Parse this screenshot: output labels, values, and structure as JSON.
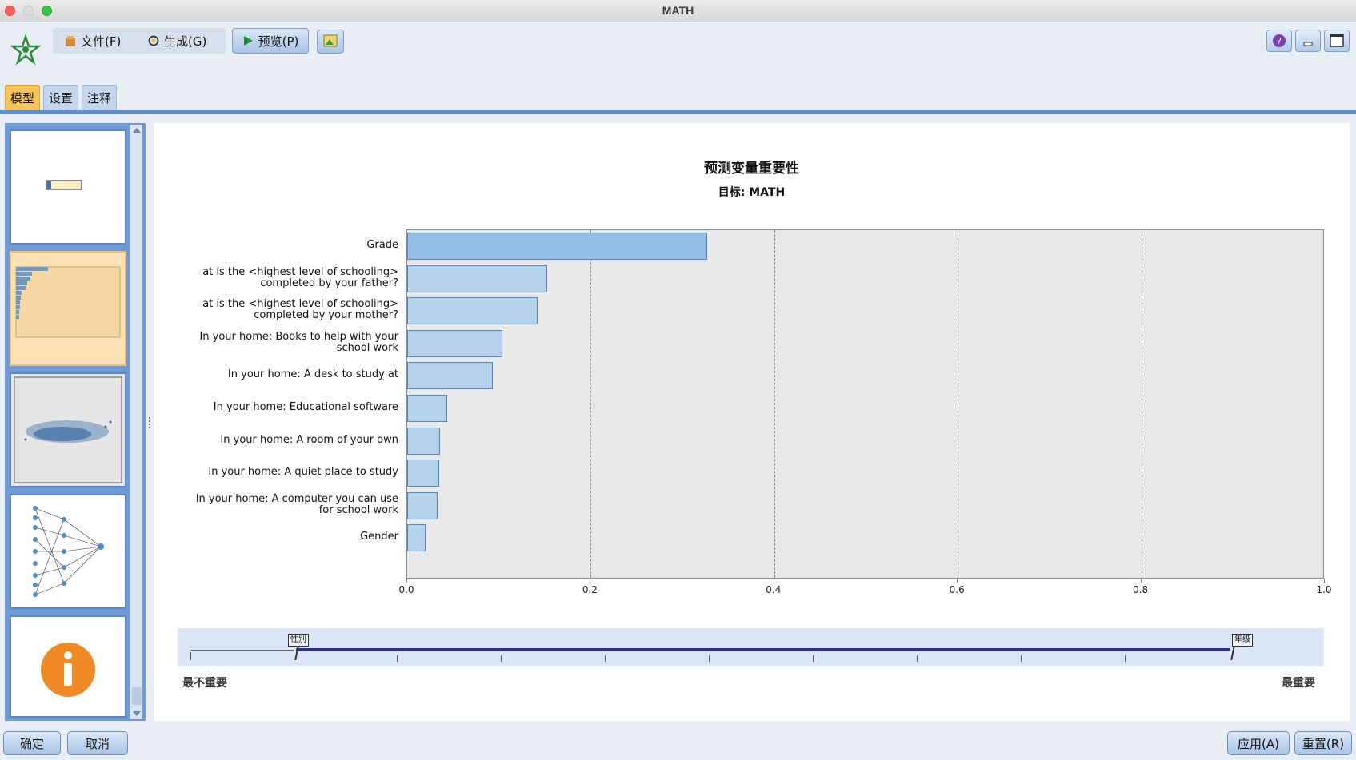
{
  "window": {
    "title": "MATH"
  },
  "toolbar": {
    "file_label": "文件(F)",
    "generate_label": "生成(G)",
    "preview_label": "预览(P)"
  },
  "tabs": [
    {
      "label": "模型",
      "active": true
    },
    {
      "label": "设置",
      "active": false
    },
    {
      "label": "注释",
      "active": false
    }
  ],
  "colors": {
    "accent": "#5b8fd2",
    "bar_fill": "#b6d1ea",
    "bar_border": "#4f88c3",
    "tab_active": "#f6c55a",
    "info_icon": "#f08a24"
  },
  "chart_data": {
    "type": "bar",
    "orientation": "horizontal",
    "title": "预测变量重要性",
    "subtitle": "目标:  MATH",
    "categories": [
      "Grade",
      "at is the <highest level of schooling> completed by your father?",
      "at is the <highest level of schooling> completed by your mother?",
      "In your home: Books to help with your school work",
      "In your home: A desk to study at",
      "In your home: Educational software",
      "In your home: A room of your own",
      "In your home: A quiet place to study",
      "In your home: A computer you can use for school work",
      "Gender"
    ],
    "category_lines": [
      [
        "Grade"
      ],
      [
        "at is the <highest level of schooling>",
        "completed by your father?"
      ],
      [
        "at is the <highest level of schooling>",
        "completed by your mother?"
      ],
      [
        "In your home: Books to help with your",
        "school work"
      ],
      [
        "In your home: A desk to study at"
      ],
      [
        "In your home: Educational software"
      ],
      [
        "In your home: A room of your own"
      ],
      [
        "In your home: A quiet place to study"
      ],
      [
        "In your home: A computer you can use",
        "for school work"
      ],
      [
        "Gender"
      ]
    ],
    "values": [
      0.327,
      0.153,
      0.142,
      0.104,
      0.093,
      0.044,
      0.036,
      0.035,
      0.033,
      0.02
    ],
    "xlim": [
      0.0,
      1.0
    ],
    "xticks": [
      "0.0",
      "0.2",
      "0.4",
      "0.6",
      "0.8",
      "1.0"
    ],
    "grid": true
  },
  "slider": {
    "left_handle_label": "性别",
    "right_handle_label": "年级",
    "min_label": "最不重要",
    "max_label": "最重要"
  },
  "footer": {
    "ok_label": "确定",
    "cancel_label": "取消",
    "apply_label": "应用(A)",
    "reset_label": "重置(R)"
  }
}
